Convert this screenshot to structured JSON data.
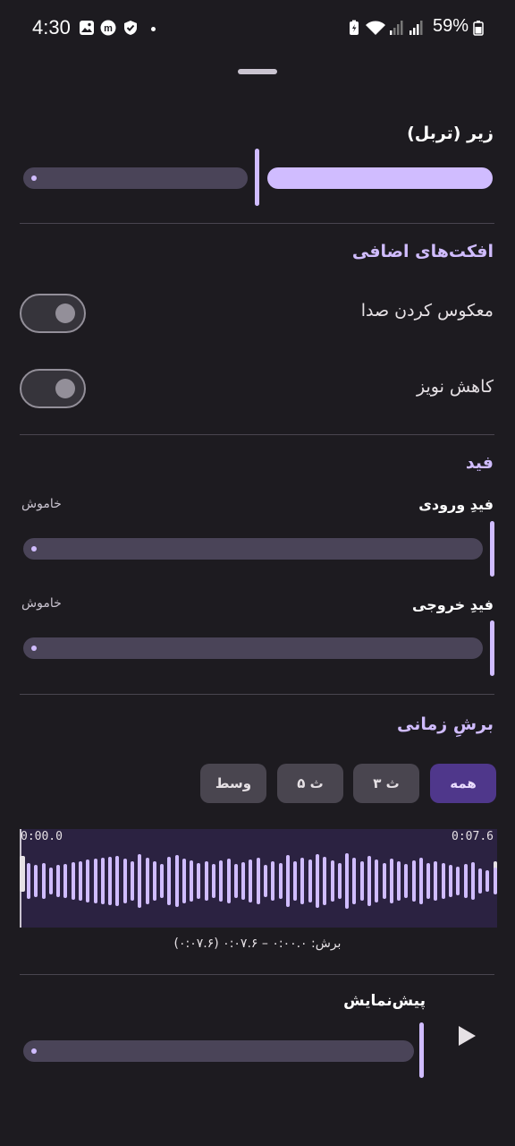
{
  "status_bar": {
    "time": "4:30",
    "battery": "59%"
  },
  "treble": {
    "title": "زیر (تربل)",
    "value": 0.5
  },
  "effects": {
    "title": "افکت‌های اضافی",
    "reverse_label": "معکوس کردن صدا",
    "noise_label": "کاهش نویز"
  },
  "fade": {
    "title": "فید",
    "fade_in_label": "فیدِ ورودی",
    "fade_in_value": "خاموش",
    "fade_out_label": "فیدِ خروجی",
    "fade_out_value": "خاموش"
  },
  "trim": {
    "title": "برشِ زمانی",
    "chips": [
      "همه",
      "۳ ث",
      "۵ ث",
      "وسط"
    ],
    "start_time": "0:00.0",
    "end_time": "0:07.6",
    "summary": "برش: ۰:۰۰.۰ – ۰:۰۷.۶ (۰:۰۷.۶)"
  },
  "preview": {
    "title": "پیش‌نمایش"
  },
  "colors": {
    "accent": "#d0bcff",
    "background": "#1d1b20",
    "chip_active": "#4f378b"
  }
}
